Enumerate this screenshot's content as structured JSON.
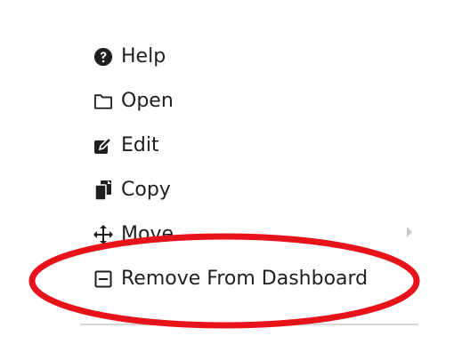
{
  "menu": {
    "items": [
      {
        "label": "Help",
        "icon": "question-circle-icon"
      },
      {
        "label": "Open",
        "icon": "folder-open-icon"
      },
      {
        "label": "Edit",
        "icon": "edit-icon"
      },
      {
        "label": "Copy",
        "icon": "copy-icon"
      },
      {
        "label": "Move",
        "icon": "move-icon",
        "has_submenu": true
      },
      {
        "label": "Remove From Dashboard",
        "icon": "minus-square-icon"
      }
    ]
  },
  "annotation": {
    "highlight_color": "#e8121b",
    "highlighted_item": "Remove From Dashboard"
  }
}
